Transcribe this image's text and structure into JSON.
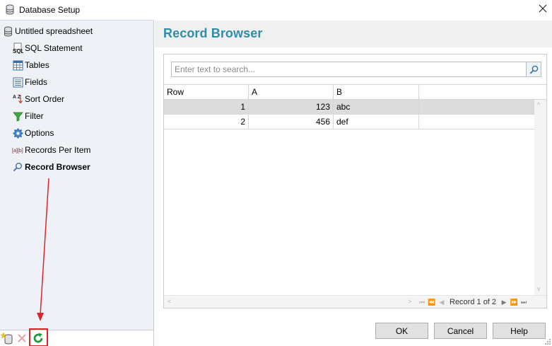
{
  "window": {
    "title": "Database Setup",
    "close_glyph": "✕"
  },
  "sidebar": {
    "root_label": "Untitled spreadsheet",
    "items": [
      {
        "label": "SQL Statement",
        "icon": "sql-icon"
      },
      {
        "label": "Tables",
        "icon": "table-icon"
      },
      {
        "label": "Fields",
        "icon": "fields-icon"
      },
      {
        "label": "Sort Order",
        "icon": "sort-az-icon"
      },
      {
        "label": "Filter",
        "icon": "filter-icon"
      },
      {
        "label": "Options",
        "icon": "gear-icon"
      },
      {
        "label": "Records Per Item",
        "icon": "records-per-item-icon"
      },
      {
        "label": "Record Browser",
        "icon": "magnifier-icon",
        "active": true
      }
    ],
    "toolbar": [
      "new-database-icon",
      "delete-icon",
      "refresh-icon"
    ],
    "sql_icon_text": "SQL",
    "sort_icon_text": "A Z",
    "records_icon_text": "[a][b]"
  },
  "record_browser": {
    "title": "Record Browser",
    "search_placeholder": "Enter text to search...",
    "columns": [
      "Row",
      "A",
      "B"
    ],
    "rows": [
      {
        "row": "1",
        "a": "123",
        "b": "abc"
      },
      {
        "row": "2",
        "a": "456",
        "b": "def"
      }
    ],
    "record_nav": "Record 1 of 2",
    "nav_glyphs": {
      "first": "⏮",
      "prev_page": "⏪",
      "prev": "◀",
      "next": "▶",
      "next_page": "⏩",
      "last": "⏭"
    },
    "scroll_glyphs": {
      "left": "<",
      "right": ">",
      "up": "^",
      "down": "v"
    }
  },
  "buttons": {
    "ok": "OK",
    "cancel": "Cancel",
    "help": "Help"
  },
  "colors": {
    "accent_title": "#2c8eaa",
    "annotation_red": "#d9262a",
    "selected_row": "#dcdcdc"
  }
}
